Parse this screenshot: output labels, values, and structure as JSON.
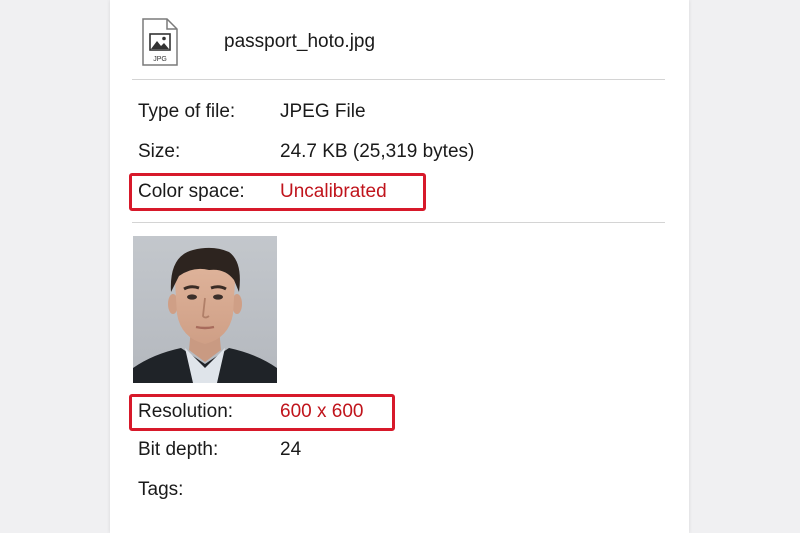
{
  "file": {
    "name": "passport_hoto.jpg",
    "icon": "jpg-file-icon",
    "icon_label": "JPG"
  },
  "properties_top": [
    {
      "label": "Type of file:",
      "value": "JPEG File"
    },
    {
      "label": "Size:",
      "value": "24.7 KB (25,319 bytes)"
    },
    {
      "label": "Color space:",
      "value": "Uncalibrated"
    }
  ],
  "properties_bottom": [
    {
      "label": "Resolution:",
      "value": "600 x 600"
    },
    {
      "label": "Bit depth:",
      "value": "24"
    },
    {
      "label": "Tags:",
      "value": ""
    }
  ],
  "colors": {
    "highlight": "#d7192a",
    "highlight_text": "#c0141c",
    "panel": "#ffffff",
    "background": "#f0f0f2"
  }
}
